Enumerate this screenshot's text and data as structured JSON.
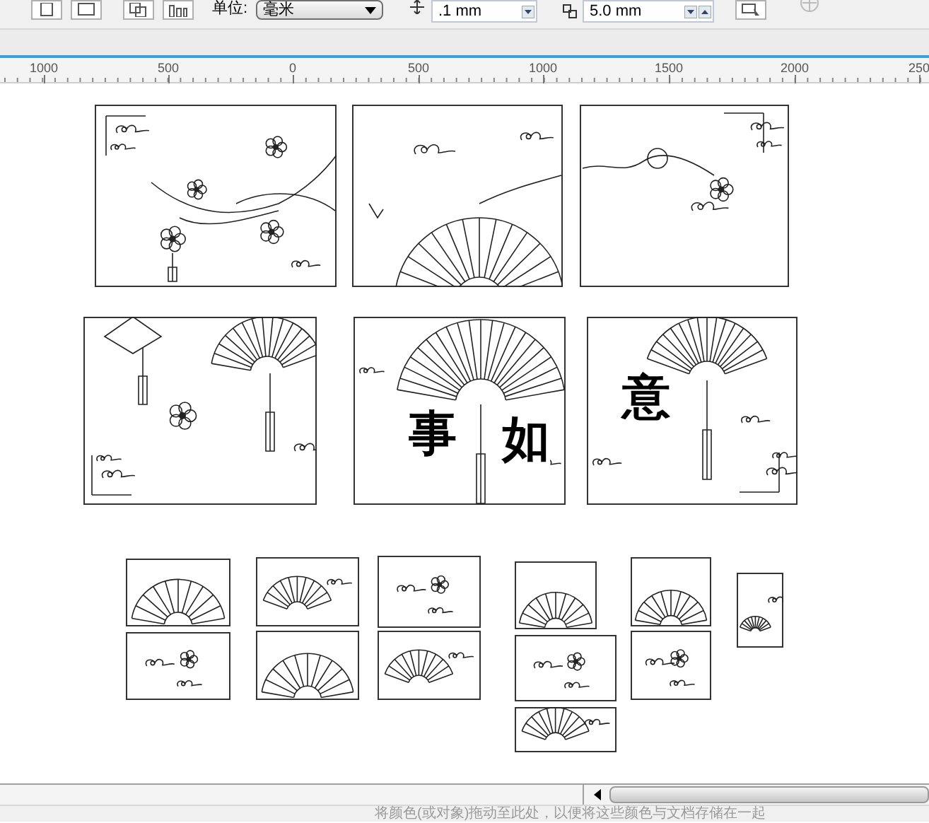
{
  "toolbar": {
    "unit_label": "单位:",
    "unit_value": "毫米",
    "nudge": ".1 mm",
    "duplicate_offset": "5.0 mm"
  },
  "ruler": [
    "1000",
    "500",
    "0",
    "500",
    "1000",
    "1500",
    "2000",
    "250"
  ],
  "canvas": {
    "calligraphy": [
      "事",
      "如",
      "意"
    ]
  },
  "status_hint": "将颜色(或对象)拖动至此处，以便将这些颜色与文档存储在一起"
}
